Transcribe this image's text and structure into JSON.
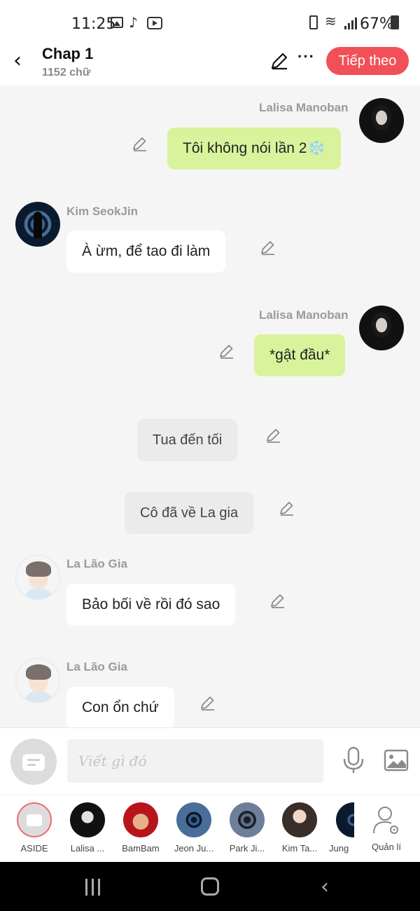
{
  "status_bar": {
    "time": "11:25",
    "battery_percent": "67%",
    "icons": [
      "gallery-icon",
      "tiktok-icon",
      "youtube-icon",
      "battery-saver-icon",
      "wifi-icon",
      "signal-icon",
      "battery-icon"
    ]
  },
  "header": {
    "back_icon": "‹",
    "title": "Chap 1",
    "word_count": "1152 chữ",
    "more_icon": "···",
    "next_label": "Tiếp theo"
  },
  "messages": [
    {
      "type": "me",
      "sender": "Lalisa Manoban",
      "text": "Tôi không nói lần 2❄️"
    },
    {
      "type": "other",
      "sender": "Kim SeokJin",
      "text": "À ừm, để tao đi làm"
    },
    {
      "type": "me",
      "sender": "Lalisa Manoban",
      "text": "*gật đầu*"
    },
    {
      "type": "narration",
      "text": "Tua đến tối"
    },
    {
      "type": "narration",
      "text": "Cô đã về La gia"
    },
    {
      "type": "other",
      "sender": "La Lão Gia",
      "text": "Bảo bối về rồi đó sao"
    },
    {
      "type": "other",
      "sender": "La Lão Gia",
      "text": "Con ổn chứ"
    }
  ],
  "input": {
    "placeholder": "Viết gì đó"
  },
  "characters": [
    {
      "label": "ASIDE"
    },
    {
      "label": "Lalisa ..."
    },
    {
      "label": "BamBam"
    },
    {
      "label": "Jeon Ju..."
    },
    {
      "label": "Park Ji..."
    },
    {
      "label": "Kim Ta..."
    },
    {
      "label": "Jung"
    }
  ],
  "manage_label": "Quản lí",
  "colors": {
    "accent": "#f25058",
    "my_bubble": "#d9f39c",
    "other_bubble": "#ffffff",
    "narration_bubble": "#ebebeb",
    "background": "#f5f5f5"
  }
}
